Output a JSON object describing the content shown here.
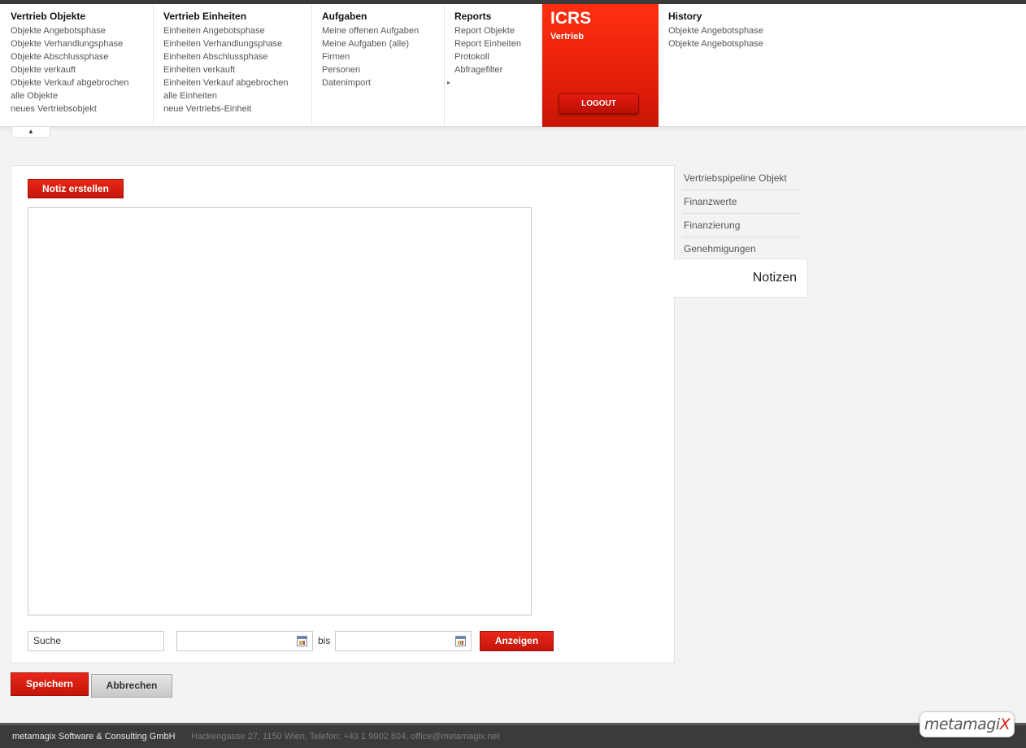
{
  "menu": {
    "columns": [
      {
        "title": "Vertrieb Objekte",
        "items": [
          "Objekte Angebotsphase",
          "Objekte Verhandlungsphase",
          "Objekte Abschlussphase",
          "Objekte verkauft",
          "Objekte Verkauf abgebrochen",
          "alle Objekte",
          "neues Vertriebsobjekt"
        ]
      },
      {
        "title": "Vertrieb Einheiten",
        "items": [
          "Einheiten Angebotsphase",
          "Einheiten Verhandlungsphase",
          "Einheiten Abschlussphase",
          "Einheiten verkauft",
          "Einheiten Verkauf abgebrochen",
          "alle Einheiten",
          "neue Vertriebs-Einheit"
        ]
      },
      {
        "title": "Aufgaben",
        "items": [
          "Meine offenen Aufgaben",
          "Meine Aufgaben (alle)",
          "Firmen",
          "Personen",
          "Datenimport"
        ]
      },
      {
        "title": "Reports",
        "items": [
          "Report Objekte",
          "Report Einheiten",
          "Protokoll",
          "Abfragefilter"
        ]
      },
      {
        "title": "History",
        "items": [
          "Objekte Angebotsphase",
          "Objekte Angebotsphase"
        ]
      }
    ],
    "submenu_arrow": "▸",
    "collapse_icon": "▲"
  },
  "brand": {
    "title": "ICRS",
    "subtitle": "Vertrieb",
    "logout_label": "LOGOUT",
    "accent": "#e51f0a"
  },
  "main": {
    "create_note_label": "Notiz erstellen",
    "search": {
      "value": "Suche"
    },
    "date_from": {
      "value": ""
    },
    "date_to": {
      "value": ""
    },
    "bis_label": "bis",
    "show_label": "Anzeigen"
  },
  "actions": {
    "save_label": "Speichern",
    "cancel_label": "Abbrechen"
  },
  "side_nav": {
    "items": [
      "Vertriebspipeline Objekt",
      "Finanzwerte",
      "Finanzierung",
      "Genehmigungen"
    ],
    "active": "Notizen"
  },
  "footer": {
    "company": "metamagix Software & Consulting GmbH",
    "address": "Hackengasse 27, 1150 Wien, Telefon: +43 1 9902 804, office@metamagix.net",
    "logo_text": "metamagi",
    "logo_accent": "X"
  }
}
